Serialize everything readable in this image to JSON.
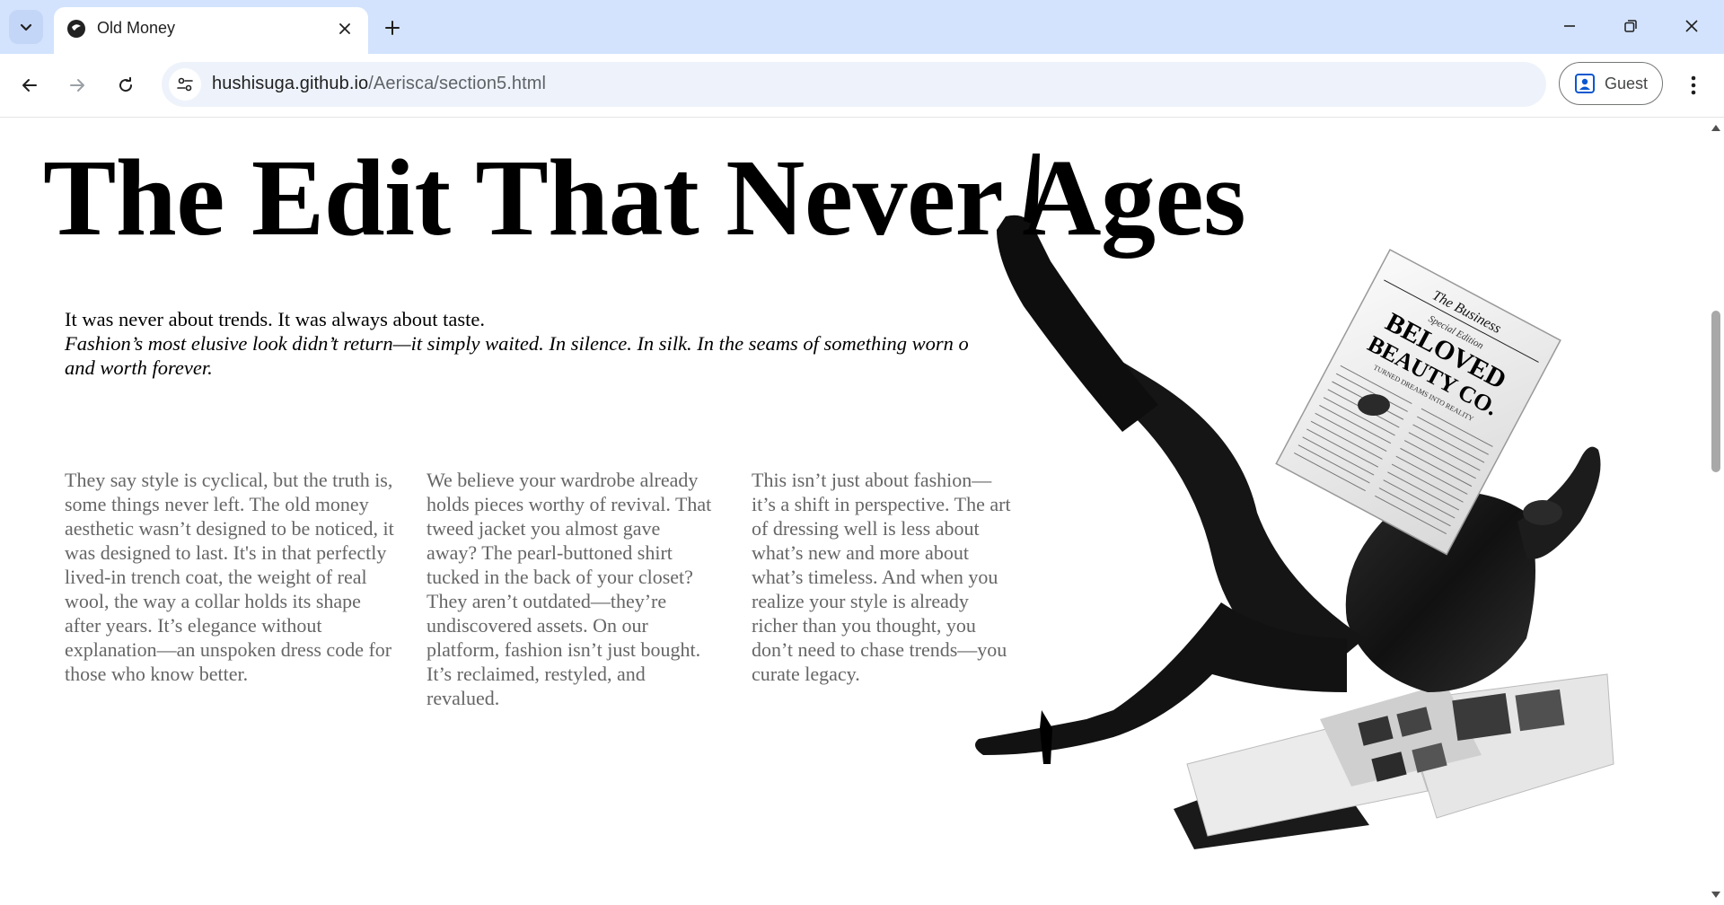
{
  "browser": {
    "tab_title": "Old Money",
    "url_domain": "hushisuga.github.io",
    "url_path": "/Aerisca/section5.html",
    "profile_label": "Guest"
  },
  "page": {
    "headline": "The Edit That Never Ages",
    "intro_line": "It was never about trends. It was always about taste.",
    "intro_italic": "Fashion’s most elusive look didn’t return—it simply waited. In silence. In silk. In the seams of something worn o",
    "intro_italic_cont": "and worth forever.",
    "columns": [
      "They say style is cyclical, but the truth is, some things never left. The old money aesthetic wasn’t designed to be noticed, it was designed to last. It's in that perfectly lived-in trench coat, the weight of real wool, the way a collar holds its shape after years. It’s elegance without explanation—an unspoken dress code for those who know better.",
      "We believe your wardrobe already holds pieces worthy of revival. That tweed jacket you almost gave away? The pearl-buttoned shirt tucked in the back of your closet? They aren’t outdated—they’re undiscovered assets. On our platform, fashion isn’t just bought. It’s reclaimed, restyled, and revalued.",
      "This isn’t just about fashion—it’s a shift in perspective. The art of dressing well is less about what’s new and more about what’s timeless. And when you realize your style is already richer than you thought, you don’t need to chase trends—you curate legacy."
    ],
    "newspaper": {
      "masthead": "The Business",
      "edition": "Special Edition",
      "headline_1": "BELOVED",
      "headline_2": "BEAUTY CO.",
      "subhead": "TURNED DREAMS INTO REALITY"
    }
  },
  "icons": {
    "tab_search": "chevron-down-icon",
    "favicon": "site-favicon-icon",
    "close": "close-icon",
    "new_tab": "plus-icon",
    "back": "back-arrow-icon",
    "forward": "forward-arrow-icon",
    "reload": "reload-icon",
    "site_info": "tune-icon",
    "profile": "profile-icon",
    "menu": "kebab-menu-icon"
  }
}
